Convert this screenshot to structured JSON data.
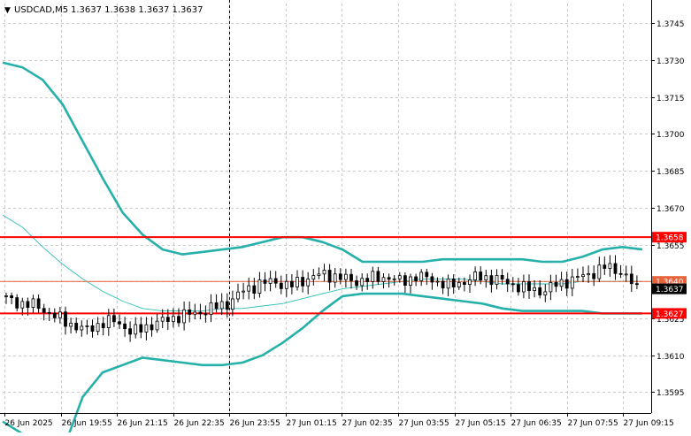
{
  "header": {
    "triangle_glyph": "▼",
    "symbol_text": "USDCAD,M5",
    "ohlc_text": "1.3637 1.3638 1.3637 1.3637"
  },
  "colors": {
    "background": "#ffffff",
    "grid": "#c8c8c8",
    "axis": "#000000",
    "text": "#000000",
    "candle": "#000000",
    "bollinger": "#26b0aa",
    "ma_thin": "#2fbdb6",
    "level_line": "#ff0000",
    "price_line": "#e8623a",
    "current_tag": "#000000"
  },
  "chart_data": {
    "type": "candlestick",
    "y_ticks": [
      "1.3745",
      "1.3730",
      "1.3715",
      "1.3700",
      "1.3685",
      "1.3670",
      "1.3655",
      "1.3640",
      "1.3625",
      "1.3610",
      "1.3595"
    ],
    "ylim": [
      1.35865,
      1.3753
    ],
    "x_ticks": [
      "26 Jun 2025",
      "26 Jun 19:55",
      "26 Jun 21:15",
      "26 Jun 22:35",
      "26 Jun 23:55",
      "27 Jun 01:15",
      "27 Jun 02:35",
      "27 Jun 03:55",
      "27 Jun 05:15",
      "27 Jun 06:35",
      "27 Jun 07:55",
      "27 Jun 09:15"
    ],
    "grid": true,
    "bollinger_upper": [
      1.3729,
      1.3727,
      1.3722,
      1.3712,
      1.3697,
      1.3682,
      1.3668,
      1.3659,
      1.3653,
      1.3651,
      1.3652,
      1.3653,
      1.3654,
      1.3656,
      1.3658,
      1.3658,
      1.3656,
      1.3653,
      1.3648,
      1.3648,
      1.3648,
      1.3648,
      1.3649,
      1.3649,
      1.3649,
      1.3649,
      1.3649,
      1.3648,
      1.3648,
      1.365,
      1.3653,
      1.3654,
      1.3653
    ],
    "bollinger_lower": [
      1.3583,
      1.3578,
      1.3574,
      1.3571,
      1.3593,
      1.3603,
      1.3606,
      1.3609,
      1.3608,
      1.3607,
      1.3606,
      1.3606,
      1.3607,
      1.361,
      1.3615,
      1.3621,
      1.3628,
      1.3634,
      1.3635,
      1.3635,
      1.3635,
      1.3634,
      1.3633,
      1.3632,
      1.3631,
      1.3629,
      1.3628,
      1.3628,
      1.3628,
      1.3628,
      1.3627,
      1.3627,
      1.3627
    ],
    "moving_average": [
      1.3667,
      1.3662,
      1.3654,
      1.3647,
      1.3641,
      1.3636,
      1.3632,
      1.3629,
      1.3628,
      1.3628,
      1.3628,
      1.3629,
      1.3629,
      1.363,
      1.3631,
      1.3633,
      1.3635,
      1.3637,
      1.3638,
      1.3639,
      1.364,
      1.3641,
      1.3641,
      1.3641,
      1.364,
      1.3639,
      1.3639,
      1.3639,
      1.3639,
      1.364,
      1.364,
      1.364,
      1.364
    ],
    "close_series": [
      1.3633,
      1.3631,
      1.363,
      1.3626,
      1.3623,
      1.362,
      1.3623,
      1.3624,
      1.3619,
      1.3622,
      1.3624,
      1.3626,
      1.3627,
      1.3629,
      1.3631,
      1.3636,
      1.3639,
      1.364,
      1.3638,
      1.3641,
      1.3643,
      1.3642,
      1.364,
      1.3641,
      1.3642,
      1.364,
      1.3642,
      1.3641,
      1.3638,
      1.364,
      1.3642,
      1.3641,
      1.3639,
      1.3637,
      1.3636,
      1.3639,
      1.3641,
      1.3643,
      1.3646,
      1.3644,
      1.3637
    ],
    "levels": [
      {
        "label": "1.3658",
        "value": 1.3658
      },
      {
        "label": "1.3627",
        "value": 1.3627
      }
    ],
    "price_line": {
      "label": "1.3640",
      "value": 1.364
    },
    "current_price": {
      "label": "1.3637",
      "value": 1.3637
    },
    "crosshair_x_tick": "26 Jun 23:55"
  }
}
